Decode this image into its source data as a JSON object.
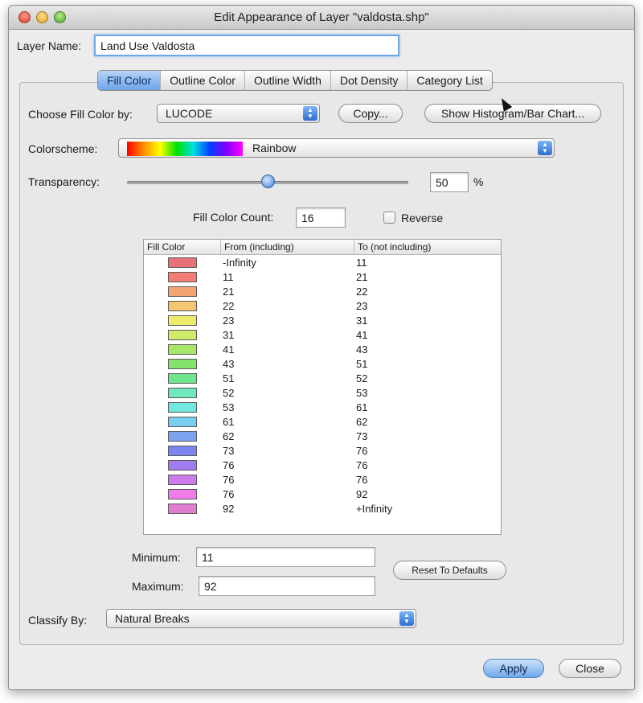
{
  "window": {
    "title": "Edit Appearance of Layer \"valdosta.shp\""
  },
  "layer": {
    "label": "Layer Name:",
    "value": "Land Use Valdosta"
  },
  "tabs": [
    {
      "label": "Fill Color",
      "active": true
    },
    {
      "label": "Outline Color",
      "active": false
    },
    {
      "label": "Outline Width",
      "active": false
    },
    {
      "label": "Dot Density",
      "active": false
    },
    {
      "label": "Category List",
      "active": false
    }
  ],
  "fill": {
    "choose_label": "Choose Fill Color by:",
    "choose_value": "LUCODE",
    "copy_button": "Copy...",
    "histogram_button": "Show Histogram/Bar Chart..."
  },
  "colorscheme": {
    "label": "Colorscheme:",
    "value": "Rainbow"
  },
  "transparency": {
    "label": "Transparency:",
    "value": "50",
    "unit": "%",
    "level": 0.5
  },
  "count": {
    "label": "Fill Color Count:",
    "value": "16"
  },
  "reverse": {
    "label": "Reverse",
    "checked": false
  },
  "table": {
    "headers": [
      "Fill Color",
      "From (including)",
      "To (not including)"
    ],
    "rows": [
      {
        "color": "#e8727a",
        "from": "-Infinity",
        "to": "11"
      },
      {
        "color": "#f27e76",
        "from": "11",
        "to": "21"
      },
      {
        "color": "#f3a672",
        "from": "21",
        "to": "22"
      },
      {
        "color": "#f2c76f",
        "from": "22",
        "to": "23"
      },
      {
        "color": "#ecec6c",
        "from": "23",
        "to": "31"
      },
      {
        "color": "#cfeb6a",
        "from": "31",
        "to": "41"
      },
      {
        "color": "#a6e669",
        "from": "41",
        "to": "43"
      },
      {
        "color": "#84e36d",
        "from": "43",
        "to": "51"
      },
      {
        "color": "#6fe68e",
        "from": "51",
        "to": "52"
      },
      {
        "color": "#6fe8bc",
        "from": "52",
        "to": "53"
      },
      {
        "color": "#72e6e0",
        "from": "53",
        "to": "61"
      },
      {
        "color": "#79cdf0",
        "from": "61",
        "to": "62"
      },
      {
        "color": "#7ba3ee",
        "from": "62",
        "to": "73"
      },
      {
        "color": "#7d84ee",
        "from": "73",
        "to": "76"
      },
      {
        "color": "#a07cee",
        "from": "76",
        "to": "76"
      },
      {
        "color": "#cd7cec",
        "from": "76",
        "to": "76"
      },
      {
        "color": "#ef7ce8",
        "from": "76",
        "to": "92"
      },
      {
        "color": "#e07fd0",
        "from": "92",
        "to": "+Infinity"
      }
    ]
  },
  "minimum": {
    "label": "Minimum:",
    "value": "11"
  },
  "maximum": {
    "label": "Maximum:",
    "value": "92"
  },
  "reset_button": "Reset To Defaults",
  "classify": {
    "label": "Classify By:",
    "value": "Natural Breaks"
  },
  "apply_button": "Apply",
  "close_button": "Close",
  "colors": {
    "accent": "#6fa7ec",
    "window_bg": "#ececec"
  }
}
